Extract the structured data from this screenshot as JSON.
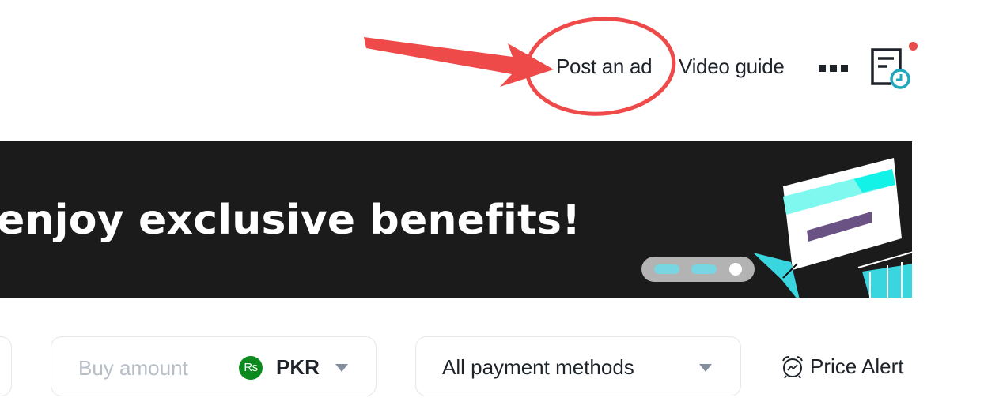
{
  "header": {
    "nav": [
      {
        "label": "Post an ad",
        "highlighted": true
      },
      {
        "label": "Video guide"
      }
    ],
    "more_icon": "more-horizontal-icon",
    "orders_icon": "order-history-icon",
    "orders_has_notification": true
  },
  "annotation": {
    "type": "arrow-and-circle",
    "target": "Post an ad",
    "color": "#ef4a4a"
  },
  "banner": {
    "text": "enjoy exclusive benefits!",
    "background": "#1b1b1b",
    "pager": {
      "total": 3,
      "active": 3
    }
  },
  "filters": {
    "amount": {
      "placeholder": "Buy amount",
      "value": "",
      "currency_symbol": "Rs",
      "currency_code": "PKR"
    },
    "payment": {
      "selected": "All payment methods"
    },
    "price_alert": {
      "label": "Price Alert"
    }
  },
  "colors": {
    "text": "#1e2329",
    "placeholder": "#b7bdc6",
    "currency_badge": "#0c8a1e",
    "accent_teal": "#1ea7bd",
    "notification_dot": "#e84c4c"
  }
}
